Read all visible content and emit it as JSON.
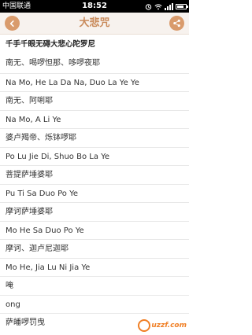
{
  "status_bar": {
    "carrier": "中国联通",
    "time": "18:52"
  },
  "header": {
    "title": "大悲咒"
  },
  "subtitle": "千手千眼无碍大悲心陀罗尼",
  "lines": [
    "南无、喝啰怛那、哆啰夜耶",
    "Na Mo, He La Da Na, Duo La Ye Ye",
    "南无、阿唎耶",
    "Na Mo, A Li Ye",
    "婆卢羯帝、烁钵啰耶",
    "Po Lu Jie Di, Shuo Bo La Ye",
    "菩提萨埵婆耶",
    "Pu Ti Sa Duo Po Ye",
    "摩诃萨埵婆耶",
    "Mo He Sa Duo Po Ye",
    "摩诃、迦卢尼迦耶",
    "Mo He, Jia Lu Ni Jia Ye",
    "唵",
    "ong",
    "萨皤啰罚曳"
  ],
  "watermark": "uzzf.com",
  "colors": {
    "accent": "#d99b6c",
    "title": "#c98a5a",
    "header_bg": "#f7f2ee"
  },
  "icons": {
    "back": "chevron-left-icon",
    "share": "share-icon"
  }
}
